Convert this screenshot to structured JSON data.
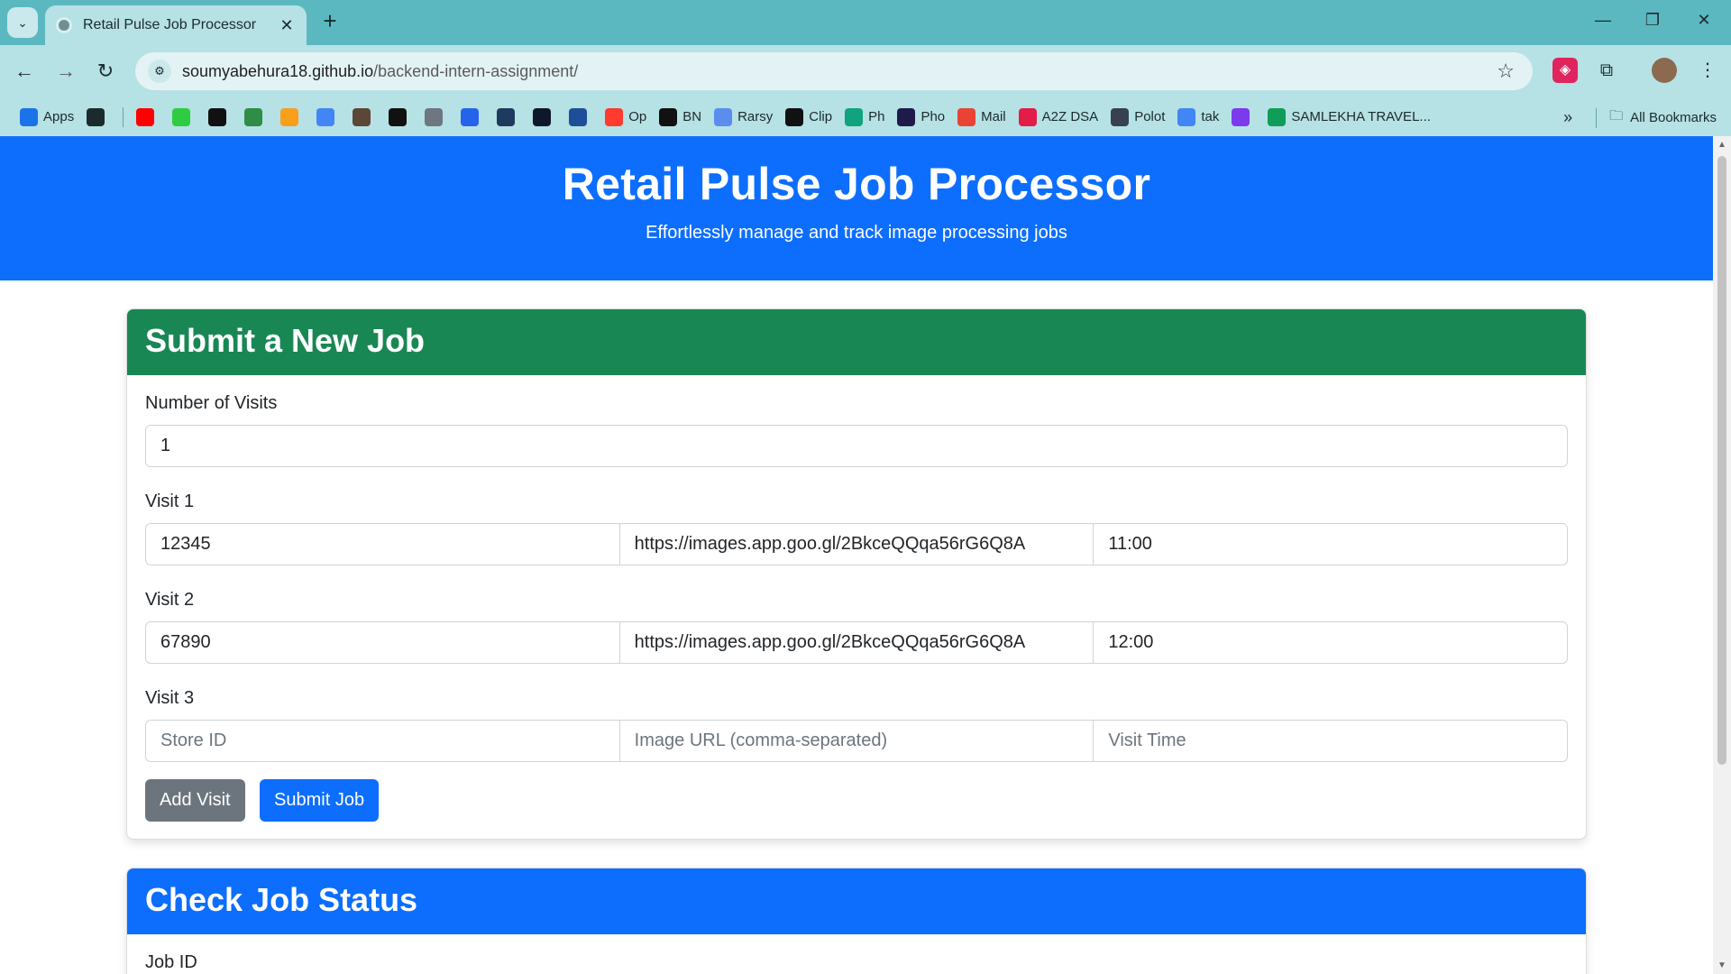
{
  "browser": {
    "tab_title": "Retail Pulse Job Processor",
    "url_domain": "soumyabehura18.github.io",
    "url_path": "/backend-intern-assignment/",
    "bookmarks": [
      {
        "label": "Apps",
        "icon": "apps-grid-icon",
        "color": "#1a73e8"
      },
      {
        "label": "",
        "icon": "grid-icon",
        "color": "#1b2b2d"
      },
      {
        "label": "",
        "icon": "youtube-icon",
        "color": "#ff0000"
      },
      {
        "label": "",
        "icon": "green-circle-icon",
        "color": "#2ecc40"
      },
      {
        "label": "",
        "icon": "hacker-icon",
        "color": "#111111"
      },
      {
        "label": "",
        "icon": "gfg-icon",
        "color": "#2f8d46"
      },
      {
        "label": "",
        "icon": "leetcode-icon",
        "color": "#f89f1b"
      },
      {
        "label": "",
        "icon": "chart-icon",
        "color": "#4285f4"
      },
      {
        "label": "",
        "icon": "codechef-icon",
        "color": "#5b4638"
      },
      {
        "label": "",
        "icon": "openai-icon",
        "color": "#111111"
      },
      {
        "label": "",
        "icon": "github-icon",
        "color": "#6e7681"
      },
      {
        "label": "",
        "icon": "blue-app-icon",
        "color": "#2563eb"
      },
      {
        "label": "",
        "icon": "hashnode-icon",
        "color": "#1e3a5f"
      },
      {
        "label": "",
        "icon": "d-icon",
        "color": "#0f172a"
      },
      {
        "label": "",
        "icon": "unstop-icon",
        "color": "#1f4e99"
      },
      {
        "label": "Op",
        "icon": "opera-icon",
        "color": "#ff3b2f"
      },
      {
        "label": "BN",
        "icon": "tv-icon",
        "color": "#111111"
      },
      {
        "label": "Rarsy",
        "icon": "rarsy-icon",
        "color": "#5b8def"
      },
      {
        "label": "Clip",
        "icon": "clip-icon",
        "color": "#111111"
      },
      {
        "label": "Ph",
        "icon": "ph-icon",
        "color": "#10a37f"
      },
      {
        "label": "Pho",
        "icon": "r-icon",
        "color": "#1e1b4b"
      },
      {
        "label": "Mail",
        "icon": "gmail-icon",
        "color": "#ea4335"
      },
      {
        "label": "A2Z DSA",
        "icon": "tuf-icon",
        "color": "#e11d48"
      },
      {
        "label": "Polot",
        "icon": "polot-icon",
        "color": "#374151"
      },
      {
        "label": "tak",
        "icon": "google-icon",
        "color": "#4285f4"
      },
      {
        "label": "",
        "icon": "copilot-icon",
        "color": "#7c3aed"
      },
      {
        "label": "SAMLEKHA TRAVEL...",
        "icon": "sheets-icon",
        "color": "#0f9d58"
      }
    ],
    "all_bookmarks_label": "All Bookmarks"
  },
  "header": {
    "title": "Retail Pulse Job Processor",
    "subtitle": "Effortlessly manage and track image processing jobs"
  },
  "submit_card": {
    "title": "Submit a New Job",
    "header_color": "#198754",
    "visits_label": "Number of Visits",
    "visits_value": "1",
    "visits": [
      {
        "label": "Visit 1",
        "store_id": "12345",
        "image_url": "https://images.app.goo.gl/2BkceQQqa56rG6Q8A",
        "visit_time": "11:00"
      },
      {
        "label": "Visit 2",
        "store_id": "67890",
        "image_url": "https://images.app.goo.gl/2BkceQQqa56rG6Q8A",
        "visit_time": "12:00"
      },
      {
        "label": "Visit 3",
        "store_id": "",
        "image_url": "",
        "visit_time": ""
      }
    ],
    "placeholders": {
      "store_id": "Store ID",
      "image_url": "Image URL (comma-separated)",
      "visit_time": "Visit Time"
    },
    "add_visit_label": "Add Visit",
    "submit_label": "Submit Job"
  },
  "status_card": {
    "title": "Check Job Status",
    "header_color": "#0d6efd",
    "job_id_label": "Job ID"
  }
}
